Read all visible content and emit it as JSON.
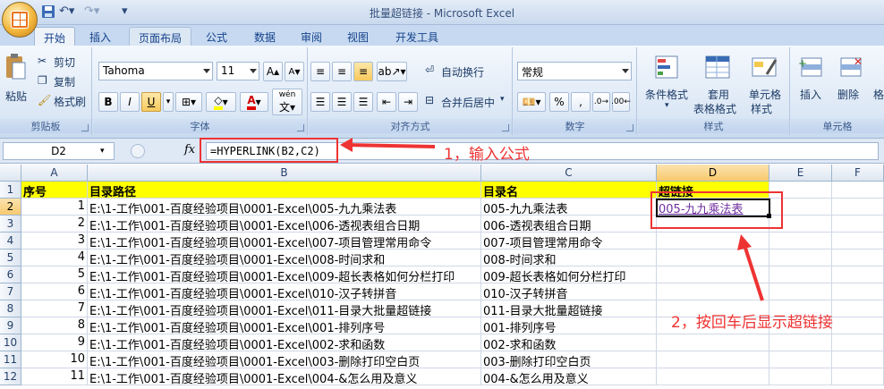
{
  "window": {
    "title": "批量超链接 - Microsoft Excel"
  },
  "tabs": [
    "开始",
    "插入",
    "页面布局",
    "公式",
    "数据",
    "审阅",
    "视图",
    "开发工具"
  ],
  "ribbon": {
    "clipboard": {
      "paste": "粘贴",
      "cut": "剪切",
      "copy": "复制",
      "format_painter": "格式刷",
      "label": "剪贴板"
    },
    "font": {
      "name": "Tahoma",
      "size": "11",
      "bold": "B",
      "italic": "I",
      "underline": "U",
      "font_color": "A",
      "phonetic": "wén",
      "label": "字体"
    },
    "alignment": {
      "wrap": "自动换行",
      "merge": "合并后居中",
      "label": "对齐方式"
    },
    "number": {
      "format": "常规",
      "percent": "%",
      "comma": ",",
      "label": "数字"
    },
    "styles": {
      "conditional": "条件格式",
      "table_line1": "套用",
      "table_line2": "表格格式",
      "cell_line1": "单元格",
      "cell_line2": "样式",
      "label": "样式"
    },
    "cells": {
      "insert": "插入",
      "delete": "删除",
      "format": "格",
      "label": "单元格"
    }
  },
  "formula_bar": {
    "name_box": "D2",
    "fx": "fx",
    "formula": "=HYPERLINK(B2,C2)"
  },
  "columns": [
    "A",
    "B",
    "C",
    "D",
    "E",
    "F"
  ],
  "rows": [
    {
      "n": "1",
      "a": "序号",
      "b": "目录路径",
      "c": "目录名",
      "d": "超链接"
    },
    {
      "n": "2",
      "a": "1",
      "b": "E:\\1-工作\\001-百度经验项目\\0001-Excel\\005-九九乘法表",
      "c": "005-九九乘法表",
      "d": "005-九九乘法表"
    },
    {
      "n": "3",
      "a": "2",
      "b": "E:\\1-工作\\001-百度经验项目\\0001-Excel\\006-透视表组合日期",
      "c": "006-透视表组合日期",
      "d": ""
    },
    {
      "n": "4",
      "a": "3",
      "b": "E:\\1-工作\\001-百度经验项目\\0001-Excel\\007-项目管理常用命令",
      "c": "007-项目管理常用命令",
      "d": ""
    },
    {
      "n": "5",
      "a": "4",
      "b": "E:\\1-工作\\001-百度经验项目\\0001-Excel\\008-时间求和",
      "c": "008-时间求和",
      "d": ""
    },
    {
      "n": "6",
      "a": "5",
      "b": "E:\\1-工作\\001-百度经验项目\\0001-Excel\\009-超长表格如何分栏打印",
      "c": "009-超长表格如何分栏打印",
      "d": ""
    },
    {
      "n": "7",
      "a": "6",
      "b": "E:\\1-工作\\001-百度经验项目\\0001-Excel\\010-汉子转拼音",
      "c": "010-汉子转拼音",
      "d": ""
    },
    {
      "n": "8",
      "a": "7",
      "b": "E:\\1-工作\\001-百度经验项目\\0001-Excel\\011-目录大批量超链接",
      "c": "011-目录大批量超链接",
      "d": ""
    },
    {
      "n": "9",
      "a": "8",
      "b": "E:\\1-工作\\001-百度经验项目\\0001-Excel\\001-排列序号",
      "c": "001-排列序号",
      "d": ""
    },
    {
      "n": "10",
      "a": "9",
      "b": "E:\\1-工作\\001-百度经验项目\\0001-Excel\\002-求和函数",
      "c": "002-求和函数",
      "d": ""
    },
    {
      "n": "11",
      "a": "10",
      "b": "E:\\1-工作\\001-百度经验项目\\0001-Excel\\003-删除打印空白页",
      "c": "003-删除打印空白页",
      "d": ""
    },
    {
      "n": "12",
      "a": "11",
      "b": "E:\\1-工作\\001-百度经验项目\\0001-Excel\\004-&怎么用及意义",
      "c": "004-&怎么用及意义",
      "d": ""
    }
  ],
  "annotations": {
    "step1": "1，输入公式",
    "step2": "2，按回车后显示超链接",
    "color": "#e33333"
  }
}
